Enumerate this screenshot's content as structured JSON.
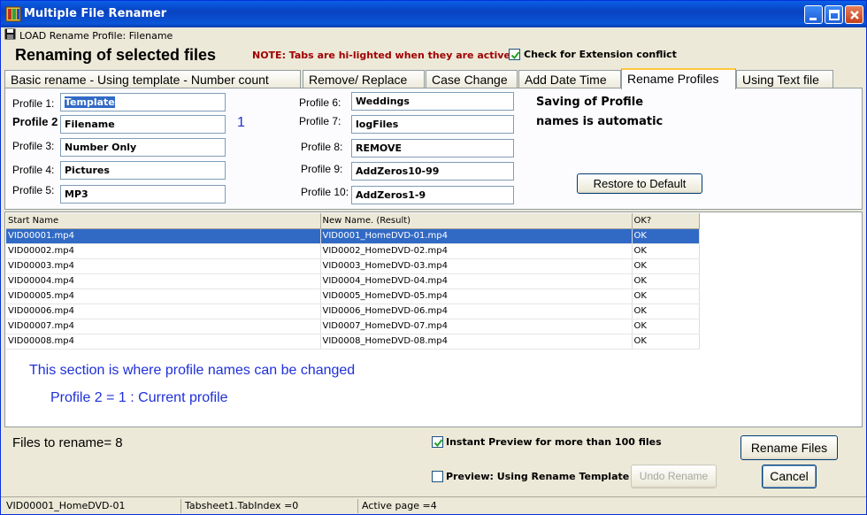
{
  "window": {
    "title": "Multiple File Renamer"
  },
  "load_profile": {
    "label": "LOAD Rename Profile: Filename"
  },
  "header": {
    "title": "Renaming of selected files",
    "note": "NOTE: Tabs are hi-lighted when they are active.",
    "ext_conflict_label": "Check for Extension conflict",
    "ext_conflict_checked": true
  },
  "tabs": [
    {
      "label": "Basic rename - Using template - Number count",
      "active": false
    },
    {
      "label": "Remove/ Replace",
      "active": false
    },
    {
      "label": "Case Change",
      "active": false
    },
    {
      "label": "Add Date Time",
      "active": false
    },
    {
      "label": "Rename Profiles",
      "active": true
    },
    {
      "label": "Using Text file",
      "active": false
    }
  ],
  "profiles": [
    {
      "label": "Profile 1:",
      "value": "Template"
    },
    {
      "label": "Profile 2",
      "value": "Filename"
    },
    {
      "label": "Profile 3:",
      "value": "Number Only"
    },
    {
      "label": "Profile 4:",
      "value": "Pictures"
    },
    {
      "label": "Profile 5:",
      "value": "MP3"
    },
    {
      "label": "Profile 6:",
      "value": "Weddings"
    },
    {
      "label": "Profile 7:",
      "value": "logFiles"
    },
    {
      "label": "Profile 8:",
      "value": "REMOVE"
    },
    {
      "label": "Profile 9:",
      "value": "AddZeros10-99"
    },
    {
      "label": "Profile 10:",
      "value": "AddZeros1-9"
    }
  ],
  "current_profile_number": "1",
  "saving_note": {
    "line1": "Saving of Profile",
    "line2": "names is automatic"
  },
  "restore_button": "Restore to Default",
  "grid": {
    "columns": [
      "Start Name",
      "New Name. (Result)",
      "OK?"
    ],
    "rows": [
      [
        "VID00001.mp4",
        "VID0001_HomeDVD-01.mp4",
        "OK"
      ],
      [
        "VID00002.mp4",
        "VID0002_HomeDVD-02.mp4",
        "OK"
      ],
      [
        "VID00003.mp4",
        "VID0003_HomeDVD-03.mp4",
        "OK"
      ],
      [
        "VID00004.mp4",
        "VID0004_HomeDVD-04.mp4",
        "OK"
      ],
      [
        "VID00005.mp4",
        "VID0005_HomeDVD-05.mp4",
        "OK"
      ],
      [
        "VID00006.mp4",
        "VID0006_HomeDVD-06.mp4",
        "OK"
      ],
      [
        "VID00007.mp4",
        "VID0007_HomeDVD-07.mp4",
        "OK"
      ],
      [
        "VID00008.mp4",
        "VID0008_HomeDVD-08.mp4",
        "OK"
      ]
    ],
    "selected_row": 0
  },
  "info": {
    "line1": "This section is where profile names can be changed",
    "line2": "Profile 2 =    1 : Current profile"
  },
  "footer": {
    "files_to_rename": "Files to rename= 8",
    "instant_preview_label": "Instant Preview for more than 100 files",
    "instant_preview_checked": true,
    "preview_template_label": "Preview: Using Rename Template",
    "preview_template_checked": false,
    "undo_button": "Undo Rename",
    "rename_button": "Rename Files",
    "cancel_button": "Cancel"
  },
  "statusbar": {
    "seg1": "VID00001_HomeDVD-01",
    "seg2": "Tabsheet1.TabIndex =0",
    "seg3": "Active page =4"
  },
  "colors": {
    "titlebar": "#0a55d8",
    "selection": "#316ac5",
    "info_text": "#1e30d8",
    "note_text": "#a00000",
    "active_tab_accent": "#ffc83c"
  }
}
